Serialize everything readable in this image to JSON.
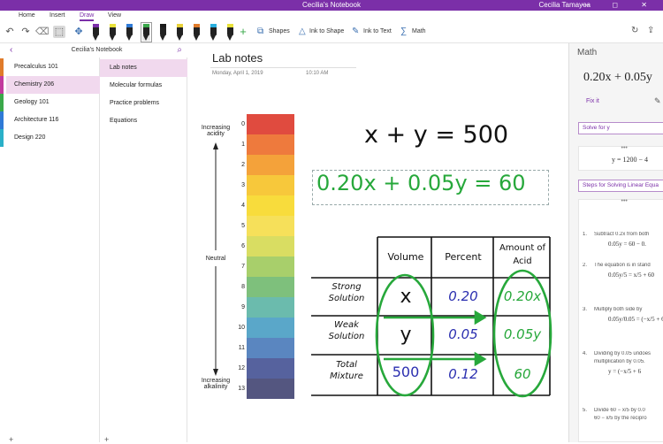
{
  "window": {
    "title": "Cecilia's Notebook",
    "user": "Cecilia Tamayoa",
    "controls": "— ◻ ✕"
  },
  "ribbon_tabs": [
    "Home",
    "Insert",
    "Draw",
    "View"
  ],
  "toolbar": {
    "undo": "↶",
    "redo": "↷",
    "lasso": "⬚",
    "pan": "✥",
    "shapes_label": "Shapes",
    "ink_to_shape_label": "Ink to Shape",
    "ink_to_text_label": "Ink to Text",
    "math_label": "Math",
    "add": "+",
    "pens": [
      {
        "color": "#222222",
        "band": "#7b2fa8",
        "selected": false
      },
      {
        "color": "#222222",
        "band": "#e9e23a",
        "selected": false
      },
      {
        "color": "#222222",
        "band": "#2f7ad6",
        "selected": false
      },
      {
        "color": "#222222",
        "band": "#3aa84a",
        "selected": true
      },
      {
        "color": "#222222",
        "band": "#1a1a1a",
        "selected": false
      },
      {
        "color": "#222222",
        "band": "#e9d23a",
        "selected": false
      },
      {
        "color": "#222222",
        "band": "#e07b2a",
        "selected": false
      },
      {
        "color": "#222222",
        "band": "#2ab0e0",
        "selected": false
      },
      {
        "color": "#222222",
        "band": "#e9e23a",
        "selected": false
      }
    ]
  },
  "notebook": {
    "name": "Cecilia's Notebook",
    "back": "‹",
    "search": "⌕"
  },
  "sections": [
    {
      "label": "Precalculus 101",
      "color": "#e07b2a",
      "active": false
    },
    {
      "label": "Chemistry 206",
      "color": "#c23a9e",
      "active": true
    },
    {
      "label": "Geology 101",
      "color": "#3aa84a",
      "active": false
    },
    {
      "label": "Architecture 116",
      "color": "#2f7ad6",
      "active": false
    },
    {
      "label": "Design 220",
      "color": "#2ab0c8",
      "active": false
    }
  ],
  "pages": [
    {
      "label": "Lab notes",
      "active": true
    },
    {
      "label": "Molecular formulas",
      "active": false
    },
    {
      "label": "Practice problems",
      "active": false
    },
    {
      "label": "Equations",
      "active": false
    }
  ],
  "bottom_add": "+",
  "page": {
    "title": "Lab notes",
    "date": "Monday, April 1, 2019",
    "time": "10:10 AM"
  },
  "ph_scale": {
    "top_label": "Increasing acidity",
    "middle_label": "Neutral",
    "bottom_label": "Increasing alkalinity",
    "levels": [
      {
        "n": "0",
        "color": "#e04b3f"
      },
      {
        "n": "1",
        "color": "#ee7a3d"
      },
      {
        "n": "2",
        "color": "#f4a23a"
      },
      {
        "n": "3",
        "color": "#f7c83b"
      },
      {
        "n": "4",
        "color": "#f8dc3c"
      },
      {
        "n": "5",
        "color": "#f6e05a"
      },
      {
        "n": "6",
        "color": "#d9dd62"
      },
      {
        "n": "7",
        "color": "#a8cf6b"
      },
      {
        "n": "8",
        "color": "#7ec07c"
      },
      {
        "n": "9",
        "color": "#6bbbad"
      },
      {
        "n": "10",
        "color": "#5aa7c9"
      },
      {
        "n": "11",
        "color": "#5a86c0"
      },
      {
        "n": "12",
        "color": "#56629e"
      },
      {
        "n": "13",
        "color": "#545680"
      }
    ]
  },
  "ink": {
    "eq1": "x + y = 500",
    "eq2": "0.20x + 0.05y = 60",
    "table": {
      "headers": [
        "Volume",
        "Percent",
        "Amount of Acid"
      ],
      "rows": [
        {
          "label": "Strong Solution",
          "volume": "x",
          "percent": "0.20",
          "amount": "0.20x"
        },
        {
          "label": "Weak Solution",
          "volume": "y",
          "percent": "0.05",
          "amount": "0.05y"
        },
        {
          "label": "Total Mixture",
          "volume": "500",
          "percent": "0.12",
          "amount": "60"
        }
      ]
    }
  },
  "math": {
    "title": "Math",
    "expression": "0.20x + 0.05y",
    "fix_it": "Fix it",
    "solve_for": "Solve for y",
    "result": "y = 1200 − 4",
    "steps_header": "Steps for Solving Linear Equa",
    "steps": [
      {
        "n": "1.",
        "text": "Subtract 0.2x from both",
        "eq": "0.05y = 60 − 0."
      },
      {
        "n": "2.",
        "text": "The equation is in stand",
        "eq": "0.05y/5 = x/5 + 60"
      },
      {
        "n": "3.",
        "text": "Multiply both side by",
        "eq": "0.05y/0.05 = (−x/5 + 6"
      },
      {
        "n": "4.",
        "text": "Dividing by 0.05 undoes",
        "text2": "multiplication by 0.05.",
        "eq": "y = (−x/5 + 6"
      },
      {
        "n": "5.",
        "text": "Divide 60 − x/5 by 0.0",
        "text2": "60 − x/5 by the recipro",
        "eq": ""
      }
    ]
  }
}
